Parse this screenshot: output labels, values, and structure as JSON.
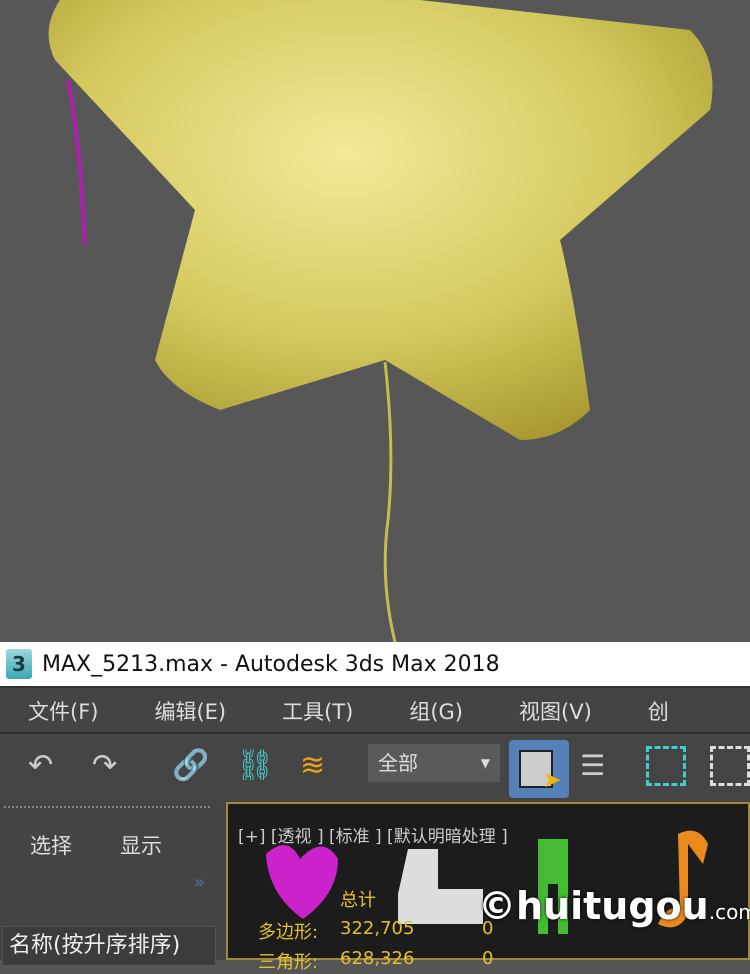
{
  "window": {
    "title": "MAX_5213.max - Autodesk 3ds Max 2018",
    "app_icon": "3"
  },
  "menu": [
    "文件(F)",
    "编辑(E)",
    "工具(T)",
    "组(G)",
    "视图(V)",
    "创"
  ],
  "toolbar": {
    "filter_value": "全部",
    "icons": [
      "undo-icon",
      "redo-icon",
      "link-icon",
      "unlink-icon",
      "bind-space-warp-icon",
      "select-object-icon",
      "select-by-name-icon",
      "rect-selection-icon",
      "window-crossing-icon"
    ]
  },
  "scene_explorer": {
    "tabs": [
      "选择",
      "显示"
    ],
    "expand": "»",
    "column_header": "名称(按升序排序)"
  },
  "viewport": {
    "label": "[+] [透视 ] [标准 ] [默认明暗处理 ]",
    "stats_title": "总计",
    "stats": [
      {
        "label": "多边形:",
        "total": "322,705",
        "selected": "0"
      },
      {
        "label": "三角形:",
        "total": "628,326",
        "selected": "0"
      }
    ]
  },
  "watermark": {
    "text": "huitugou",
    "suffix": ".com"
  },
  "colors": {
    "accent": "#5680b8",
    "balloon": "#d8cf6a",
    "stats": "#e0c030"
  }
}
